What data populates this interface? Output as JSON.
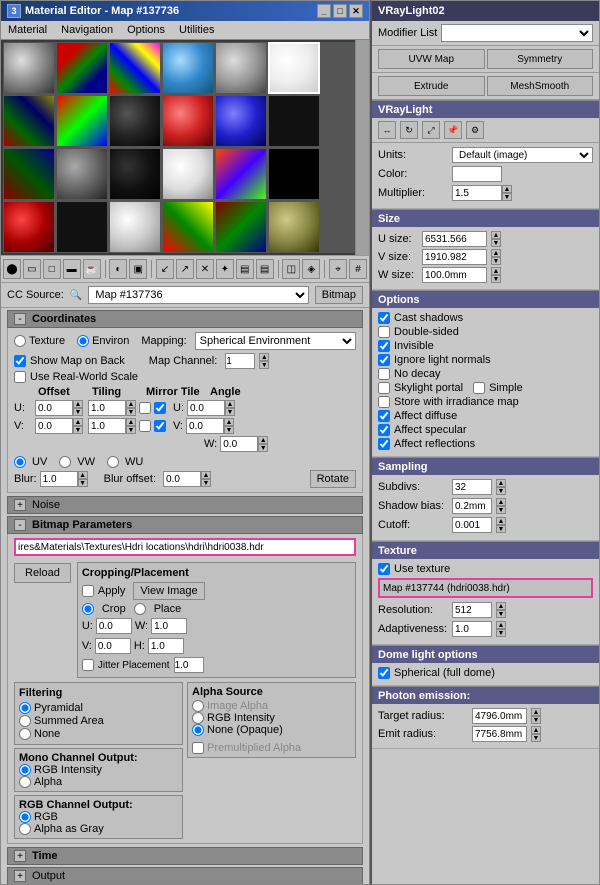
{
  "leftPanel": {
    "titleBar": {
      "title": "Material Editor - Map #137736",
      "icon": "3"
    },
    "menuItems": [
      "Material",
      "Navigation",
      "Options",
      "Utilities"
    ],
    "toolbar": {
      "icons": [
        "sphere",
        "cylinder",
        "box",
        "plane",
        "teapot",
        "background",
        "backlight",
        "sample-uv",
        "video-color",
        "magnify",
        "select",
        "put-to",
        "get-from",
        "delete",
        "options",
        "mat-effects",
        "show-map",
        "show-end",
        "select-all",
        "reset"
      ]
    },
    "ccSource": {
      "label": "CC Source:",
      "value": "Map #137736",
      "type": "Bitmap"
    },
    "coordinates": {
      "header": "Coordinates",
      "texture": "Texture",
      "environ": "Environ",
      "mapping": "Mapping:",
      "mappingValue": "Spherical Environment",
      "showMapOnBack": "Show Map on Back",
      "mapChannel": "Map Channel:",
      "mapChannelValue": "1",
      "useRealWorldScale": "Use Real-World Scale",
      "offset": "Offset",
      "tiling": "Tiling",
      "mirrorTile": "Mirror Tile",
      "angle": "Angle",
      "u_offset": "0.0",
      "v_offset": "0.0",
      "u_tiling": "1.0",
      "v_tiling": "1.0",
      "u_angle": "0.0",
      "v_angle": "0.0",
      "w_angle": "0.0",
      "uv_label": "UV",
      "vw_label": "VW",
      "wu_label": "WU",
      "blur": "Blur:",
      "blurValue": "1.0",
      "blurOffset": "Blur offset:",
      "blurOffsetValue": "0.0",
      "rotate": "Rotate"
    },
    "noise": {
      "header": "Noise"
    },
    "bitmapParams": {
      "header": "Bitmap Parameters",
      "path": "ires&Materials\\Textures\\Hdri locations\\hdri\\hdri0038.hdr",
      "reload": "Reload",
      "cropping": {
        "header": "Cropping/Placement",
        "apply": "Apply",
        "viewImage": "View Image",
        "crop": "Crop",
        "place": "Place",
        "u": "U:",
        "u_val": "0.0",
        "v": "V:",
        "v_val": "0.0",
        "w": "W:",
        "w_val": "1.0",
        "h": "H:",
        "h_val": "1.0",
        "jitterPlacement": "Jitter Placement",
        "jitterValue": "1.0"
      },
      "filtering": {
        "header": "Filtering",
        "pyramidal": "Pyramidal",
        "summedArea": "Summed Area",
        "none": "None"
      },
      "monoChannel": {
        "header": "Mono Channel Output:",
        "rgbIntensity": "RGB Intensity",
        "alpha": "Alpha"
      },
      "rgbChannel": {
        "header": "RGB Channel Output:",
        "rgb": "RGB",
        "alphaAsGray": "Alpha as Gray"
      },
      "alphaSource": {
        "header": "Alpha Source",
        "imageAlpha": "Image Alpha",
        "rgbIntensity": "RGB Intensity",
        "noneOpaque": "None (Opaque)",
        "premultiplied": "Premultiplied Alpha"
      }
    },
    "timeBar": {
      "label": "Time"
    },
    "outputBar": {
      "label": "Output"
    }
  },
  "rightPanel": {
    "title": "VRayLight02",
    "modifierList": {
      "label": "Modifier List",
      "value": ""
    },
    "modButtons": [
      "UVW Map",
      "Symmetry",
      "Extrude",
      "MeshSmooth"
    ],
    "vrayLight": "VRayLight",
    "iconBar": [
      "move",
      "rotate",
      "scale",
      "pin",
      "configure"
    ],
    "units": {
      "label": "Units:",
      "value": "Default (image)"
    },
    "color": {
      "label": "Color:"
    },
    "multiplier": {
      "label": "Multiplier:",
      "value": "1.5"
    },
    "size": {
      "header": "Size",
      "uSize": {
        "label": "U size:",
        "value": "6531.566"
      },
      "vSize": {
        "label": "V size:",
        "value": "1910.982"
      },
      "wSize": {
        "label": "W size:",
        "value": "100.0mm"
      }
    },
    "options": {
      "header": "Options",
      "castShadows": "Cast shadows",
      "doubleSided": "Double-sided",
      "invisible": "Invisible",
      "ignoreLightNormals": "Ignore light normals",
      "noDecay": "No decay",
      "skylightPortal": "Skylight portal",
      "simple": "Simple",
      "storeWithIrradianceMap": "Store with irradiance map",
      "affectDiffuse": "Affect diffuse",
      "affectSpecular": "Affect specular",
      "affectReflections": "Affect reflections"
    },
    "optionsChecked": {
      "castShadows": true,
      "doubleSided": false,
      "invisible": true,
      "ignoreLightNormals": true,
      "noDecay": false,
      "skylightPortal": false,
      "simple": false,
      "storeWithIrradianceMap": false,
      "affectDiffuse": true,
      "affectSpecular": true,
      "affectReflections": true
    },
    "sampling": {
      "header": "Sampling",
      "subdivs": {
        "label": "Subdivs:",
        "value": "32"
      },
      "shadowBias": {
        "label": "Shadow bias:",
        "value": "0.2mm"
      },
      "cutoff": {
        "label": "Cutoff:",
        "value": "0.001"
      }
    },
    "texture": {
      "header": "Texture",
      "useTexture": "Use texture",
      "useTextureChecked": true,
      "mapLabel": "Map #137744 (hdri0038.hdr)",
      "resolution": {
        "label": "Resolution:",
        "value": "512"
      },
      "adaptiveness": {
        "label": "Adaptiveness:",
        "value": "1.0"
      }
    },
    "domeLightOptions": {
      "header": "Dome light options",
      "spherical": "Spherical (full dome)",
      "sphericalChecked": true
    },
    "photonEmission": {
      "header": "Photon emission:",
      "targetRadius": {
        "label": "Target radius:",
        "value": "4796.0mm"
      },
      "emitRadius": {
        "label": "Emit radius:",
        "value": "7756.8mm"
      }
    }
  }
}
